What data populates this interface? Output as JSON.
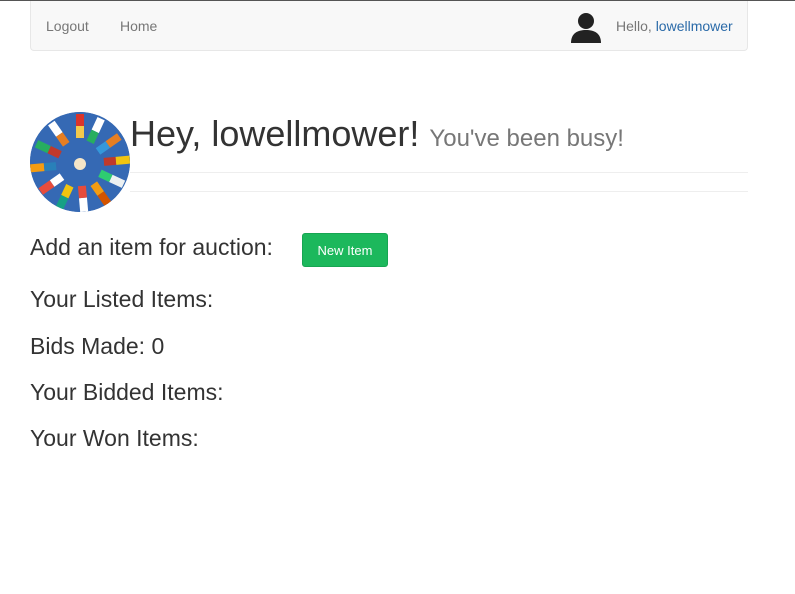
{
  "nav": {
    "logout_label": "Logout",
    "home_label": "Home",
    "greeting_prefix": "Hello, ",
    "username_link": "lowellmower"
  },
  "profile": {
    "heading": "Hey, lowellmower!",
    "subheading": "You've been busy!"
  },
  "sections": {
    "add_item_label": "Add an item for auction:",
    "new_item_button": "New Item",
    "listed_items_label": "Your Listed Items:",
    "bids_made_label": "Bids Made: 0",
    "bidded_items_label": "Your Bidded Items:",
    "won_items_label": "Your Won Items:"
  },
  "icons": {
    "user": "user-silhouette-icon",
    "avatar": "prayer-flags-photo"
  },
  "colors": {
    "link": "#2a6aa8",
    "button": "#1cb85c",
    "navbar_bg": "#f8f8f8"
  }
}
